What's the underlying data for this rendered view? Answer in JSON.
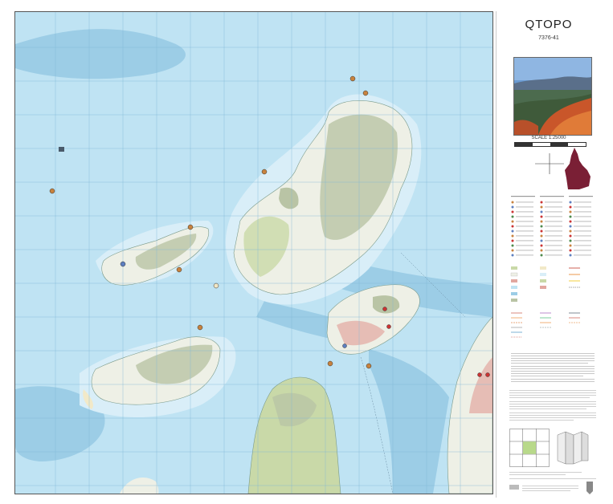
{
  "panel": {
    "title": "QTOPO",
    "sheet_number": "7376-41",
    "scale": "SCALE 1:25000"
  },
  "map": {
    "colors": {
      "sea": "#bfe3f3",
      "deep_sea": "#9ccde6",
      "shallow": "#d9eef8",
      "land": "#eef0e6",
      "vegetation": "#c9d9a8",
      "hills": "#b9c4a5",
      "urban": "#e2a7a0"
    },
    "icons": [
      "camping-icon",
      "anchor-icon",
      "poi-icon"
    ]
  }
}
